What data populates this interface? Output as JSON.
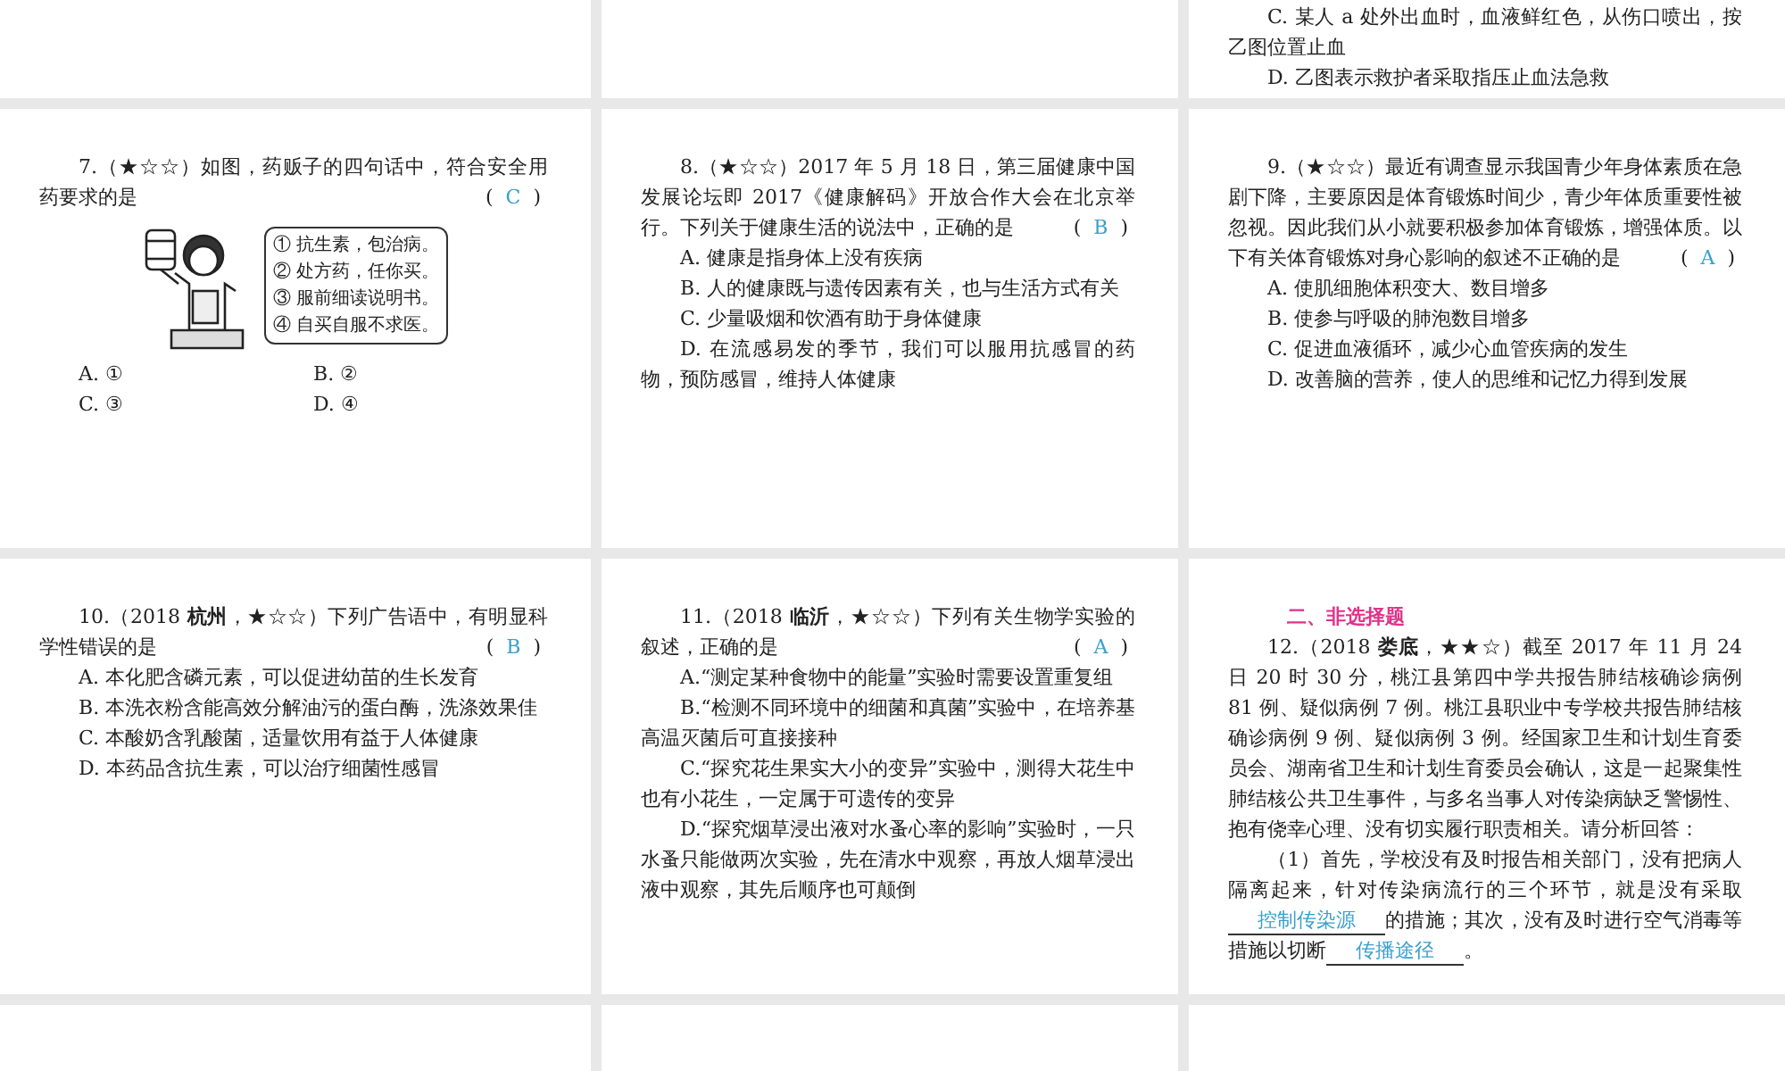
{
  "slides": [
    {
      "kind": "blank"
    },
    {
      "kind": "blank"
    },
    {
      "kind": "text",
      "blocks": [
        {
          "kind": "option",
          "text": "C. 某人 a 处外出血时，血液鲜红色，从伤口喷出，按乙图位置止血"
        },
        {
          "kind": "option",
          "text": "D. 乙图表示救护者采取指压止血法急救"
        }
      ]
    },
    {
      "kind": "text",
      "blocks": [
        {
          "kind": "stem",
          "text": "7.（★☆☆）如图，药贩子的四句话中，符合安全用药要求的是",
          "answer": "C",
          "bracket_open": "(",
          "bracket_close": ")"
        },
        {
          "kind": "figure",
          "lines": [
            "① 抗生素，包治病。",
            "② 处方药，任你买。",
            "③ 服前细读说明书。",
            "④ 自买自服不求医。"
          ]
        },
        {
          "kind": "option_grid",
          "items": [
            "A. ①",
            "B. ②",
            "C. ③",
            "D. ④"
          ]
        }
      ]
    },
    {
      "kind": "text",
      "blocks": [
        {
          "kind": "stem",
          "text": "8.（★☆☆）2017 年 5 月 18 日，第三届健康中国发展论坛即 2017《健康解码》开放合作大会在北京举行。下列关于健康生活的说法中，正确的是",
          "answer": "B",
          "bracket_open": "(",
          "bracket_close": ")"
        },
        {
          "kind": "option",
          "text": "A. 健康是指身体上没有疾病"
        },
        {
          "kind": "option",
          "text": "B. 人的健康既与遗传因素有关，也与生活方式有关"
        },
        {
          "kind": "option",
          "text": "C. 少量吸烟和饮酒有助于身体健康"
        },
        {
          "kind": "option",
          "text": "D. 在流感易发的季节，我们可以服用抗感冒的药物，预防感冒，维持人体健康"
        }
      ]
    },
    {
      "kind": "text",
      "blocks": [
        {
          "kind": "stem",
          "text": "9.（★☆☆）最近有调查显示我国青少年身体素质在急剧下降，主要原因是体育锻炼时间少，青少年体质重要性被忽视。因此我们从小就要积极参加体育锻炼，增强体质。以下有关体育锻炼对身心影响的叙述不正确的是",
          "answer": "A",
          "bracket_open": "(",
          "bracket_close": ")"
        },
        {
          "kind": "option",
          "text": "A. 使肌细胞体积变大、数目增多"
        },
        {
          "kind": "option",
          "text": "B. 使参与呼吸的肺泡数目增多"
        },
        {
          "kind": "option",
          "text": "C. 促进血液循环，减少心血管疾病的发生"
        },
        {
          "kind": "option",
          "text": "D. 改善脑的营养，使人的思维和记忆力得到发展"
        }
      ]
    },
    {
      "kind": "text",
      "blocks": [
        {
          "kind": "stem",
          "text": "10.（2018 **杭州**，★☆☆）下列广告语中，有明显科学性错误的是",
          "answer": "B",
          "bracket_open": "(",
          "bracket_close": ")"
        },
        {
          "kind": "option",
          "text": "A. 本化肥含磷元素，可以促进幼苗的生长发育"
        },
        {
          "kind": "option",
          "text": "B. 本洗衣粉含能高效分解油污的蛋白酶，洗涤效果佳"
        },
        {
          "kind": "option",
          "text": "C. 本酸奶含乳酸菌，适量饮用有益于人体健康"
        },
        {
          "kind": "option",
          "text": "D. 本药品含抗生素，可以治疗细菌性感冒"
        }
      ]
    },
    {
      "kind": "text",
      "blocks": [
        {
          "kind": "stem",
          "text": "11.（2018 **临沂**，★☆☆）下列有关生物学实验的叙述，正确的是",
          "answer": "A",
          "bracket_open": "(",
          "bracket_close": ")"
        },
        {
          "kind": "option",
          "text": "A.“测定某种食物中的能量”实验时需要设置重复组"
        },
        {
          "kind": "option",
          "text": "B.“检测不同环境中的细菌和真菌”实验中，在培养基高温灭菌后可直接接种"
        },
        {
          "kind": "option",
          "text": "C.“探究花生果实大小的变异”实验中，测得大花生中也有小花生，一定属于可遗传的变异"
        },
        {
          "kind": "option",
          "text": "D.“探究烟草浸出液对水蚤心率的影响”实验时，一只水蚤只能做两次实验，先在清水中观察，再放人烟草浸出液中观察，其先后顺序也可颠倒"
        }
      ]
    },
    {
      "kind": "text",
      "blocks": [
        {
          "kind": "heading",
          "text": "二、非选择题"
        },
        {
          "kind": "paragraph",
          "text": "12.（2018 **娄底**，★★☆）截至 2017 年 11 月 24 日 20 时 30 分，桃江县第四中学共报告肺结核确诊病例 81 例、疑似病例 7 例。桃江县职业中专学校共报告肺结核确诊病例 9 例、疑似病例 3 例。经国家卫生和计划生育委员会、湖南省卫生和计划生育委员会确认，这是一起聚集性肺结核公共卫生事件，与多名当事人对传染病缺乏警惕性、抱有侥幸心理、没有切实履行职责相关。请分析回答："
        },
        {
          "kind": "fill",
          "parts": [
            {
              "kind": "text",
              "text": "（1）首先，学校没有及时报告相关部门，没有把病人隔离起来，针对传染病流行的三个环节，就是没有采取"
            },
            {
              "kind": "blank",
              "text": "控制传染源"
            },
            {
              "kind": "text",
              "text": "的措施；其次，没有及时进行空气消毒等措施以切断"
            },
            {
              "kind": "blank",
              "text": "传播途径"
            },
            {
              "kind": "text",
              "text": "。"
            }
          ]
        }
      ]
    },
    {
      "kind": "blank"
    },
    {
      "kind": "blank"
    },
    {
      "kind": "blank"
    }
  ]
}
